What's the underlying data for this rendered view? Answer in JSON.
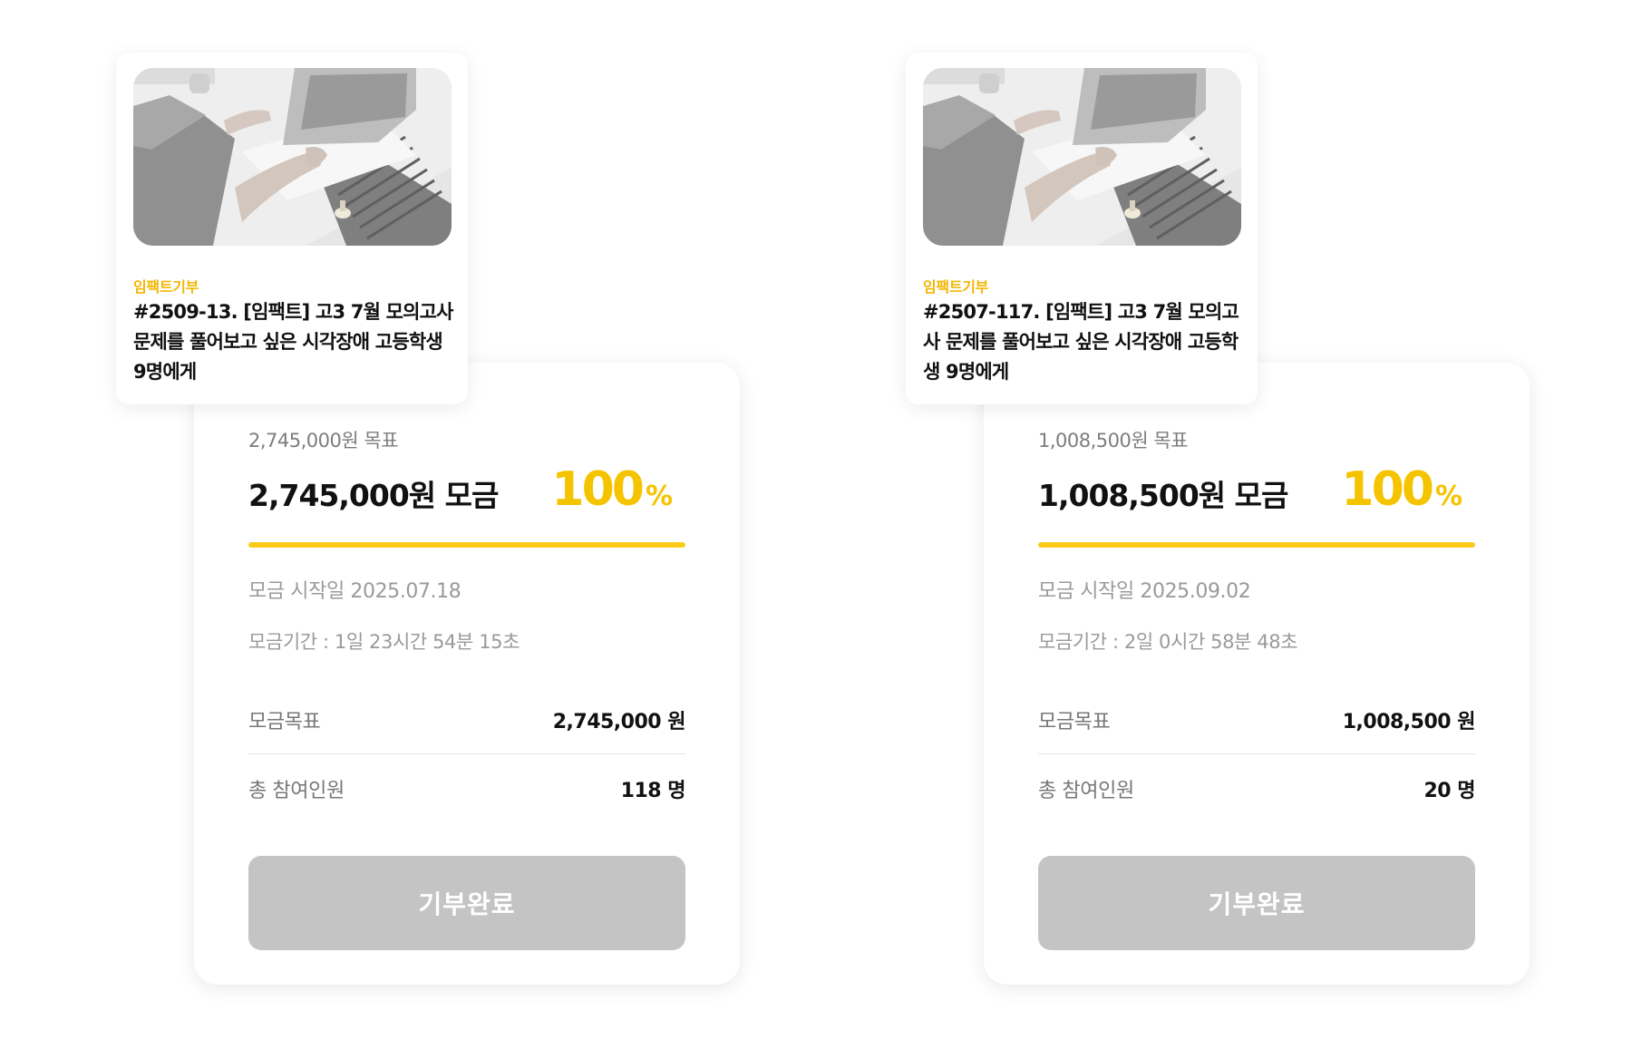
{
  "campaigns": [
    {
      "category": "임팩트기부",
      "title": "#2509-13. [임팩트] 고3 7월 모의고사 문제를 풀어보고 싶은 시각장애 고등학생 9명에게",
      "goal_line": "2,745,000원 목표",
      "raised_line": "2,745,000원 모금",
      "percent": "100",
      "percent_unit": "%",
      "progress": 100,
      "start_line": "모금 시작일 2025.07.18",
      "period_line": "모금기간 : 1일 23시간 54분 15초",
      "goal_label": "모금목표",
      "goal_value": "2,745,000 원",
      "participants_label": "총 참여인원",
      "participants_value": "118 명",
      "button_label": "기부완료"
    },
    {
      "category": "임팩트기부",
      "title": "#2507-117. [임팩트] 고3 7월 모의고사 문제를 풀어보고 싶은 시각장애 고등학생 9명에게",
      "goal_line": "1,008,500원 목표",
      "raised_line": "1,008,500원 모금",
      "percent": "100",
      "percent_unit": "%",
      "progress": 100,
      "start_line": "모금 시작일 2025.09.02",
      "period_line": "모금기간 : 2일 0시간 58분 48초",
      "goal_label": "모금목표",
      "goal_value": "1,008,500 원",
      "participants_label": "총 참여인원",
      "participants_value": "20 명",
      "button_label": "기부완료"
    }
  ],
  "colors": {
    "accent": "#fbcb1a",
    "category": "#f2b705",
    "button_disabled": "#c4c4c4"
  },
  "icons": {
    "thumbnail": "laptop-typing-photo"
  }
}
